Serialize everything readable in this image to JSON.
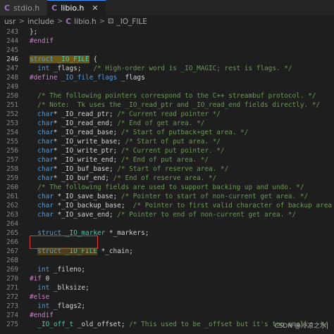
{
  "tabs": [
    {
      "icon": "C",
      "label": "stdio.h",
      "active": false
    },
    {
      "icon": "C",
      "label": "libio.h",
      "active": true
    }
  ],
  "breadcrumb": {
    "items": [
      "usr",
      "include",
      "libio.h",
      "_IO_FILE"
    ],
    "file_icon": "C",
    "separator": ">"
  },
  "lines": [
    {
      "n": "243",
      "segs": [
        [
          "p",
          "};"
        ]
      ]
    },
    {
      "n": "244",
      "segs": [
        [
          "pp",
          "#endif"
        ]
      ]
    },
    {
      "n": "245",
      "segs": []
    },
    {
      "n": "246",
      "segs": [
        [
          "kwhl",
          "struct"
        ],
        [
          "hl",
          " "
        ],
        [
          "tyhl",
          "_IO_FILE"
        ],
        [
          "p",
          " {"
        ]
      ]
    },
    {
      "n": "247",
      "segs": [
        [
          "p",
          "  "
        ],
        [
          "kw",
          "int"
        ],
        [
          "p",
          " _flags;   "
        ],
        [
          "cm",
          "/* High-order word is _IO_MAGIC; rest is flags. */"
        ]
      ]
    },
    {
      "n": "248",
      "segs": [
        [
          "pp",
          "#define"
        ],
        [
          "p",
          " "
        ],
        [
          "mac",
          "_IO_file_flags"
        ],
        [
          "p",
          " _flags"
        ]
      ]
    },
    {
      "n": "249",
      "segs": []
    },
    {
      "n": "250",
      "segs": [
        [
          "p",
          "  "
        ],
        [
          "cm",
          "/* The following pointers correspond to the C++ streambuf protocol. */"
        ]
      ]
    },
    {
      "n": "251",
      "segs": [
        [
          "p",
          "  "
        ],
        [
          "cm",
          "/* Note:  Tk uses the _IO_read_ptr and _IO_read_end fields directly. */"
        ]
      ]
    },
    {
      "n": "252",
      "segs": [
        [
          "p",
          "  "
        ],
        [
          "kw",
          "char"
        ],
        [
          "p",
          "* _IO_read_ptr; "
        ],
        [
          "cm",
          "/* Current read pointer */"
        ]
      ]
    },
    {
      "n": "253",
      "segs": [
        [
          "p",
          "  "
        ],
        [
          "kw",
          "char"
        ],
        [
          "p",
          "* _IO_read_end; "
        ],
        [
          "cm",
          "/* End of get area. */"
        ]
      ]
    },
    {
      "n": "254",
      "segs": [
        [
          "p",
          "  "
        ],
        [
          "kw",
          "char"
        ],
        [
          "p",
          "* _IO_read_base; "
        ],
        [
          "cm",
          "/* Start of putback+get area. */"
        ]
      ]
    },
    {
      "n": "255",
      "segs": [
        [
          "p",
          "  "
        ],
        [
          "kw",
          "char"
        ],
        [
          "p",
          "* _IO_write_base; "
        ],
        [
          "cm",
          "/* Start of put area. */"
        ]
      ]
    },
    {
      "n": "256",
      "segs": [
        [
          "p",
          "  "
        ],
        [
          "kw",
          "char"
        ],
        [
          "p",
          "* _IO_write_ptr; "
        ],
        [
          "cm",
          "/* Current put pointer. */"
        ]
      ]
    },
    {
      "n": "257",
      "segs": [
        [
          "p",
          "  "
        ],
        [
          "kw",
          "char"
        ],
        [
          "p",
          "* _IO_write_end; "
        ],
        [
          "cm",
          "/* End of put area. */"
        ]
      ]
    },
    {
      "n": "258",
      "segs": [
        [
          "p",
          "  "
        ],
        [
          "kw",
          "char"
        ],
        [
          "p",
          "* _IO_buf_base; "
        ],
        [
          "cm",
          "/* Start of reserve area. */"
        ]
      ]
    },
    {
      "n": "259",
      "segs": [
        [
          "p",
          "  "
        ],
        [
          "kw",
          "char"
        ],
        [
          "p",
          "* _IO_buf_end; "
        ],
        [
          "cm",
          "/* End of reserve area. */"
        ]
      ]
    },
    {
      "n": "260",
      "segs": [
        [
          "p",
          "  "
        ],
        [
          "cm",
          "/* The following fields are used to support backing up and undo. */"
        ]
      ]
    },
    {
      "n": "261",
      "segs": [
        [
          "p",
          "  "
        ],
        [
          "kw",
          "char"
        ],
        [
          "p",
          " *_IO_save_base; "
        ],
        [
          "cm",
          "/* Pointer to start of non-current get area. */"
        ]
      ]
    },
    {
      "n": "262",
      "segs": [
        [
          "p",
          "  "
        ],
        [
          "kw",
          "char"
        ],
        [
          "p",
          " *_IO_backup_base;  "
        ],
        [
          "cm",
          "/* Pointer to first valid character of backup area */"
        ]
      ]
    },
    {
      "n": "263",
      "segs": [
        [
          "p",
          "  "
        ],
        [
          "kw",
          "char"
        ],
        [
          "p",
          " *_IO_save_end; "
        ],
        [
          "cm",
          "/* Pointer to end of non-current get area. */"
        ]
      ]
    },
    {
      "n": "264",
      "segs": []
    },
    {
      "n": "265",
      "segs": [
        [
          "p",
          "  "
        ],
        [
          "kw",
          "struct"
        ],
        [
          "p",
          " "
        ],
        [
          "ty",
          "_IO_marker"
        ],
        [
          "p",
          " *_markers;"
        ]
      ]
    },
    {
      "n": "266",
      "segs": []
    },
    {
      "n": "267",
      "segs": [
        [
          "p",
          "  "
        ],
        [
          "kwhl2",
          "struct"
        ],
        [
          "hl2",
          " "
        ],
        [
          "tyhl2",
          "_IO_FILE"
        ],
        [
          "p",
          " *_chain;"
        ]
      ]
    },
    {
      "n": "268",
      "segs": []
    },
    {
      "n": "269",
      "segs": [
        [
          "p",
          "  "
        ],
        [
          "kw",
          "int"
        ],
        [
          "p",
          " _fileno;"
        ]
      ]
    },
    {
      "n": "270",
      "segs": [
        [
          "pp",
          "#if"
        ],
        [
          "p",
          " 0"
        ]
      ]
    },
    {
      "n": "271",
      "segs": [
        [
          "p",
          "  "
        ],
        [
          "kw",
          "int"
        ],
        [
          "p",
          " _blksize;"
        ]
      ]
    },
    {
      "n": "272",
      "segs": [
        [
          "pp",
          "#else"
        ]
      ]
    },
    {
      "n": "273",
      "segs": [
        [
          "p",
          "  "
        ],
        [
          "kw",
          "int"
        ],
        [
          "p",
          " _flags2;"
        ]
      ]
    },
    {
      "n": "274",
      "segs": [
        [
          "pp",
          "#endif"
        ]
      ]
    },
    {
      "n": "275",
      "segs": [
        [
          "p",
          "  "
        ],
        [
          "ty",
          "_IO_off_t"
        ],
        [
          "p",
          " _old_offset; "
        ],
        [
          "cm",
          "/* This used to be _offset but it's too small.  */"
        ]
      ]
    }
  ],
  "current_line": "246",
  "highlight_box_line": "269",
  "watermark": "CSDN @冷凉之水|",
  "colors": {
    "background": "#1e1e1e",
    "keyword": "#569cd6",
    "comment": "#6a9955",
    "type": "#4ec9b0",
    "preprocessor": "#c586c0",
    "highlight_box": "#e53935"
  }
}
